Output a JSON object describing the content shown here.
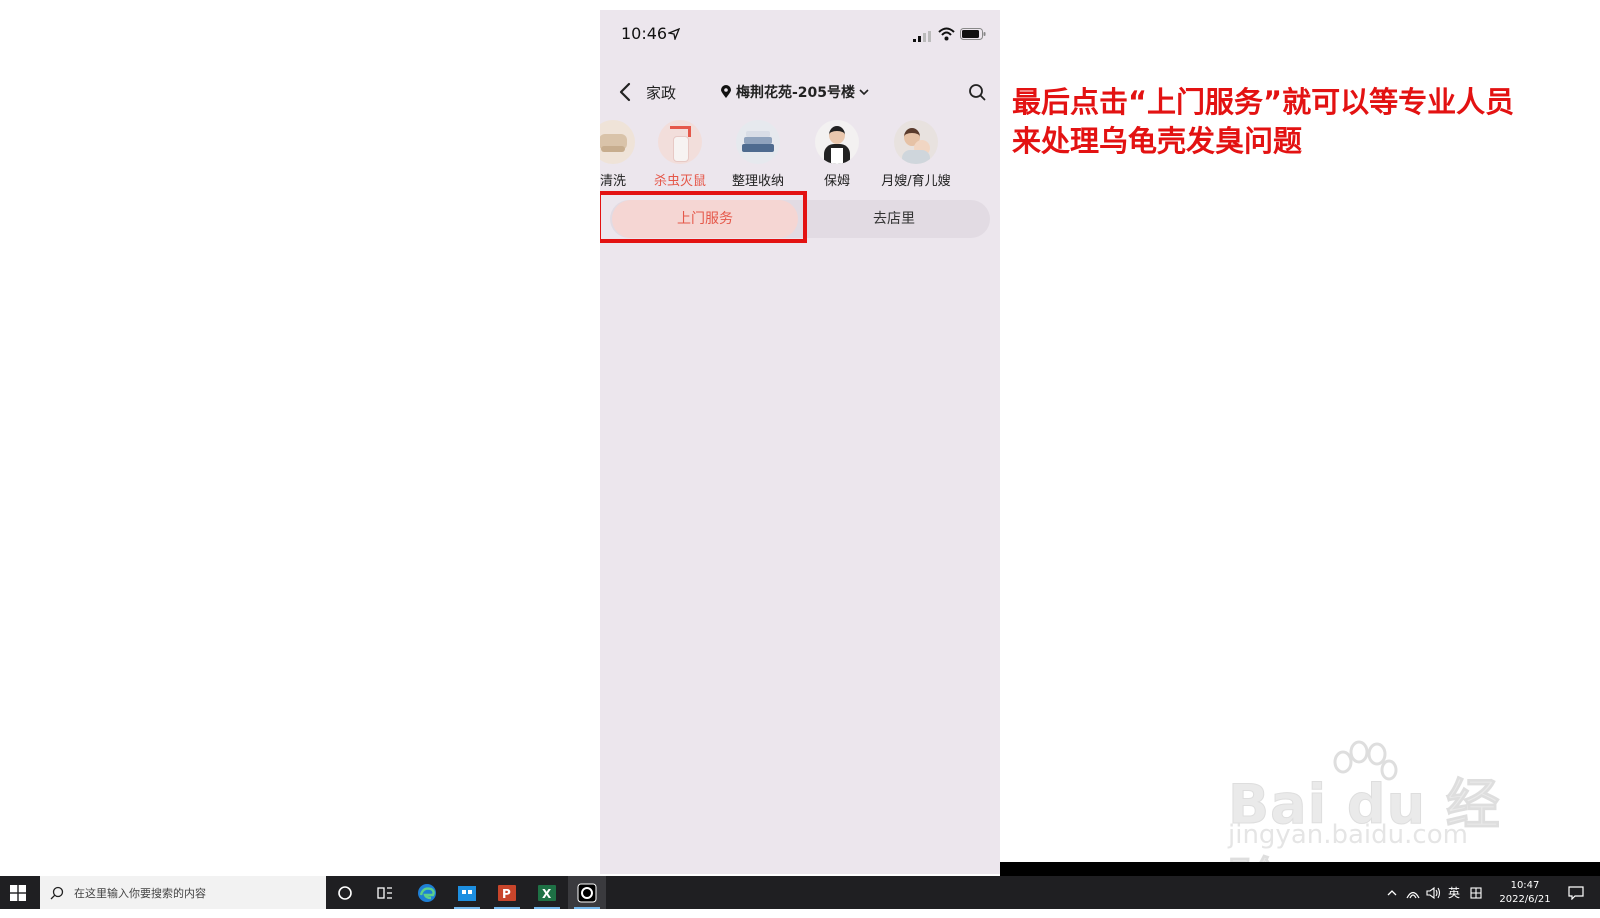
{
  "phone": {
    "status": {
      "time": "10:46"
    },
    "nav": {
      "title": "家政",
      "location": "梅荆花苑-205号楼"
    },
    "categories": [
      {
        "label": "清洗",
        "active": false
      },
      {
        "label": "杀虫灭鼠",
        "active": true
      },
      {
        "label": "整理收纳",
        "active": false
      },
      {
        "label": "保姆",
        "active": false
      },
      {
        "label": "月嫂/育儿嫂",
        "active": false
      }
    ],
    "tabs": {
      "home_service": "上门服务",
      "to_store": "去店里"
    }
  },
  "instruction": {
    "line1": "最后点击“上门服务”就可以等专业人员",
    "line2": "来处理乌龟壳发臭问题"
  },
  "watermark": {
    "brand": "Bai du 经验",
    "url": "jingyan.baidu.com"
  },
  "taskbar": {
    "search_placeholder": "在这里输入你要搜索的内容",
    "ime": "英",
    "time": "10:47",
    "date": "2022/6/21"
  },
  "colors": {
    "accent": "#e5584a",
    "highlight": "#e31212",
    "phone_bg": "#ece6ed"
  }
}
